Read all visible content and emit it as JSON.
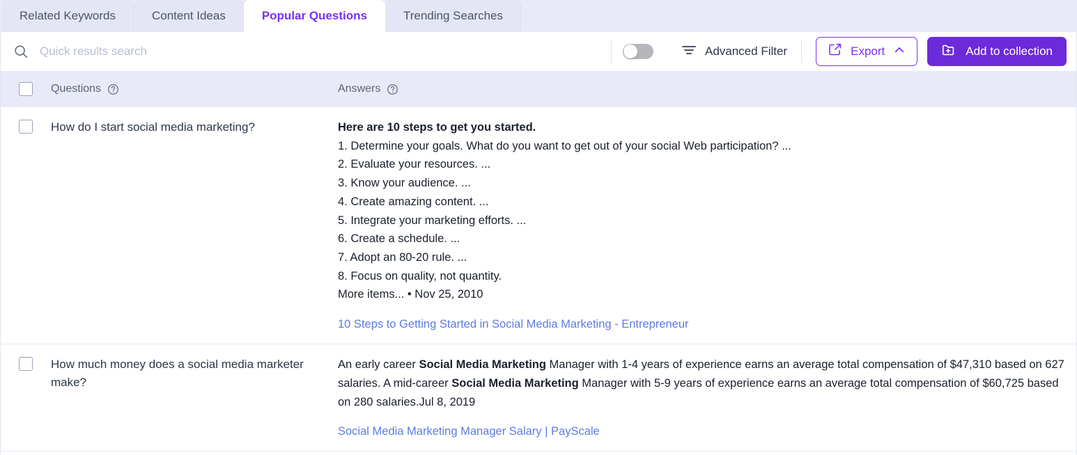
{
  "tabs": [
    {
      "label": "Related Keywords",
      "active": false
    },
    {
      "label": "Content Ideas",
      "active": false
    },
    {
      "label": "Popular Questions",
      "active": true
    },
    {
      "label": "Trending Searches",
      "active": false
    }
  ],
  "toolbar": {
    "search_placeholder": "Quick results search",
    "search_value": "",
    "toggle_state": "off",
    "filter_label": "Advanced Filter",
    "export_label": "Export",
    "add_label": "Add to collection",
    "accent_color": "#7b2ff2",
    "button_fill_color": "#6c2bd9"
  },
  "table": {
    "header": {
      "questions": "Questions",
      "answers": "Answers"
    },
    "rows": [
      {
        "question": "How do I start social media marketing?",
        "answer_heading": "Here are 10 steps to get you started.",
        "answer_steps": [
          "1. Determine your goals. What do you want to get out of your social Web participation? ...",
          "2. Evaluate your resources. ...",
          "3. Know your audience. ...",
          "4. Create amazing content. ...",
          "5. Integrate your marketing efforts. ...",
          "6. Create a schedule. ...",
          "7. Adopt an 80-20 rule. ...",
          "8. Focus on quality, not quantity."
        ],
        "answer_footer": "More items... • Nov 25, 2010",
        "source_link": "10 Steps to Getting Started in Social Media Marketing - Entrepreneur"
      },
      {
        "question": "How much money does a social media marketer make?",
        "answer_parts": [
          {
            "text": "An early career ",
            "bold": false
          },
          {
            "text": "Social Media Marketing",
            "bold": true
          },
          {
            "text": " Manager with 1-4 years of experience earns an average total compensation of $47,310 based on 627 salaries. A mid-career ",
            "bold": false
          },
          {
            "text": "Social Media Marketing",
            "bold": true
          },
          {
            "text": " Manager with 5-9 years of experience earns an average total compensation of $60,725 based on 280 salaries.Jul 8, 2019",
            "bold": false
          }
        ],
        "source_link": "Social Media Marketing Manager Salary | PayScale"
      }
    ]
  }
}
